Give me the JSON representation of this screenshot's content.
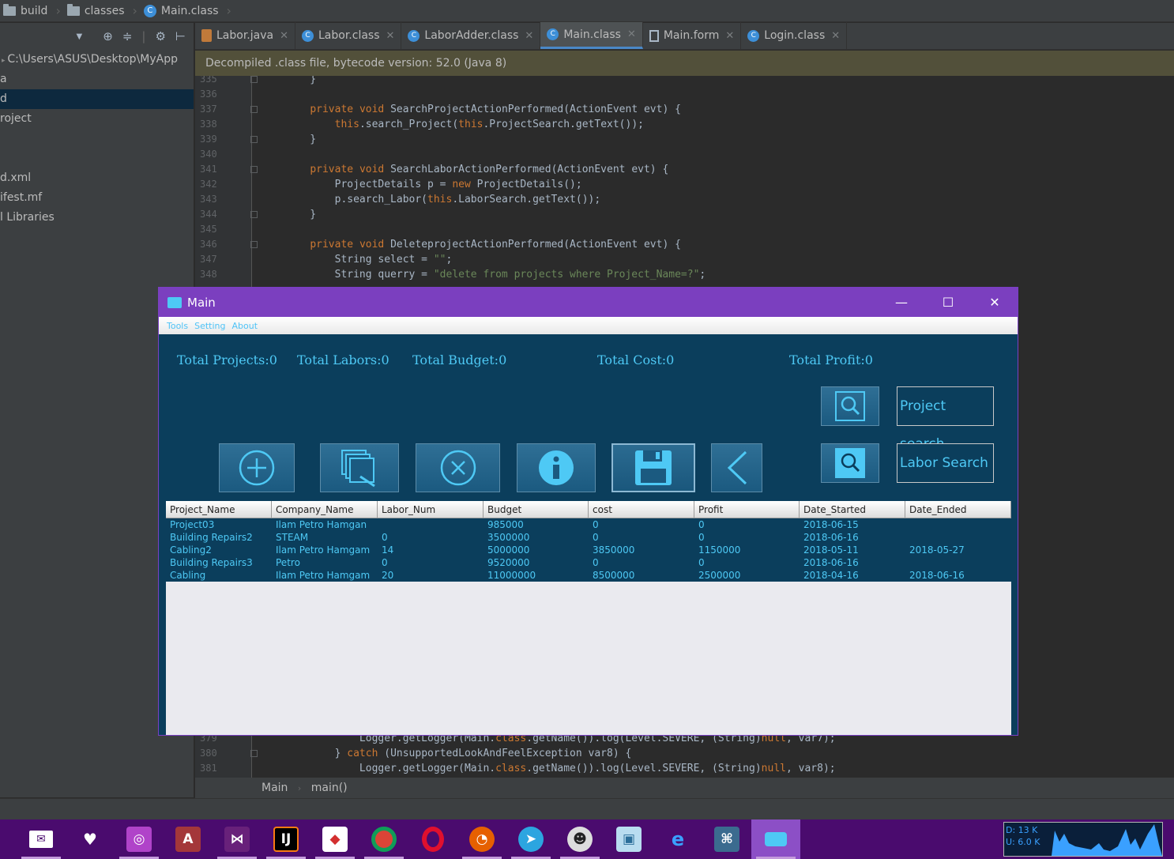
{
  "breadcrumbs": [
    {
      "label": "build",
      "icon": "folder-icon"
    },
    {
      "label": "classes",
      "icon": "folder-icon"
    },
    {
      "label": "Main.class",
      "icon": "class-file-icon"
    }
  ],
  "project_panel": {
    "items": [
      {
        "label": "C:\\Users\\ASUS\\Desktop\\MyApp"
      },
      {
        "label": "a"
      },
      {
        "label": "d"
      },
      {
        "label": "roject"
      },
      {
        "label": ""
      },
      {
        "label": ""
      },
      {
        "label": "d.xml"
      },
      {
        "label": "ifest.mf"
      },
      {
        "label": "l Libraries"
      }
    ]
  },
  "tabs": [
    {
      "label": "Labor.java",
      "type": "java"
    },
    {
      "label": "Labor.class",
      "type": "class"
    },
    {
      "label": "LaborAdder.class",
      "type": "class"
    },
    {
      "label": "Main.class",
      "type": "class"
    },
    {
      "label": "Main.form",
      "type": "form"
    },
    {
      "label": "Login.class",
      "type": "class"
    }
  ],
  "banner": "Decompiled .class file, bytecode version: 52.0 (Java 8)",
  "code_top": [
    {
      "n": "335",
      "t": "    }"
    },
    {
      "n": "336",
      "t": ""
    },
    {
      "n": "337",
      "t": "    private void SearchProjectActionPerformed(ActionEvent evt) {"
    },
    {
      "n": "338",
      "t": "        this.search_Project(this.ProjectSearch.getText());"
    },
    {
      "n": "339",
      "t": "    }"
    },
    {
      "n": "340",
      "t": ""
    },
    {
      "n": "341",
      "t": "    private void SearchLaborActionPerformed(ActionEvent evt) {"
    },
    {
      "n": "342",
      "t": "        ProjectDetails p = new ProjectDetails();"
    },
    {
      "n": "343",
      "t": "        p.search_Labor(this.LaborSearch.getText());"
    },
    {
      "n": "344",
      "t": "    }"
    },
    {
      "n": "345",
      "t": ""
    },
    {
      "n": "346",
      "t": "    private void DeleteprojectActionPerformed(ActionEvent evt) {"
    },
    {
      "n": "347",
      "t": "        String select = \"\";"
    },
    {
      "n": "348",
      "t": "        String querry = \"delete from projects where Project_Name=?\";"
    }
  ],
  "code_bottom": [
    {
      "n": "379",
      "t": "            Logger.getLogger(Main.class.getName()).log(Level.SEVERE, (String)null, var7);"
    },
    {
      "n": "380",
      "t": "        } catch (UnsupportedLookAndFeelException var8) {"
    },
    {
      "n": "381",
      "t": "            Logger.getLogger(Main.class.getName()).log(Level.SEVERE, (String)null, var8);"
    }
  ],
  "editor_breadcrumb": {
    "class": "Main",
    "method": "main()"
  },
  "window": {
    "title": "Main",
    "menu": [
      "Tools",
      "Setting",
      "About"
    ],
    "totals": {
      "projects": "Total Projects:0",
      "labors": "Total Labors:0",
      "budget": "Total Budget:0",
      "cost": "Total Cost:0",
      "profit": "Total Profit:0"
    },
    "project_search_label": "Project search",
    "labor_search_label": "Labor Search",
    "toolbar_icons": [
      "add-icon",
      "edit-icon",
      "delete-icon",
      "info-icon",
      "save-icon",
      "back-icon"
    ],
    "table": {
      "columns": [
        "Project_Name",
        "Company_Name",
        "Labor_Num",
        "Budget",
        "cost",
        "Profit",
        "Date_Started",
        "Date_Ended"
      ],
      "rows": [
        [
          "Project03",
          "Ilam Petro Hamgan",
          "",
          "985000",
          "0",
          "0",
          "2018-06-15",
          ""
        ],
        [
          "Building Repairs2",
          "STEAM",
          "0",
          "3500000",
          "0",
          "0",
          "2018-06-16",
          ""
        ],
        [
          "Cabling2",
          "Ilam Petro Hamgam",
          "14",
          "5000000",
          "3850000",
          "1150000",
          "2018-05-11",
          "2018-05-27"
        ],
        [
          "Building Repairs3",
          "Petro",
          "0",
          "9520000",
          "0",
          "0",
          "2018-06-16",
          ""
        ],
        [
          "Cabling",
          "Ilam Petro Hamgam",
          "20",
          "11000000",
          "8500000",
          "2500000",
          "2018-04-16",
          "2018-06-16"
        ]
      ]
    }
  },
  "netmon": {
    "down": "D: 13 K",
    "up": "U: 6.0 K"
  },
  "colors": {
    "accent_cyan": "#4ec9f5",
    "window_bg": "#0b3e5c",
    "titlebar": "#7b3fbf",
    "taskbar": "#4a0b6e"
  }
}
